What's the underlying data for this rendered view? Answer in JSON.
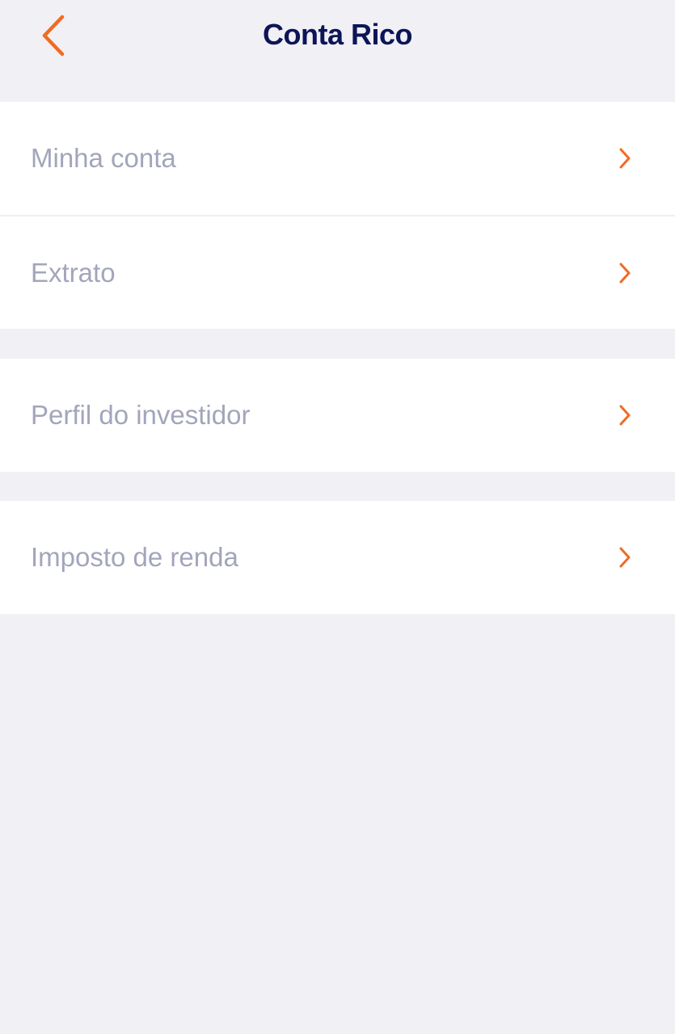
{
  "header": {
    "title": "Conta Rico",
    "back_icon": "chevron-left-icon"
  },
  "colors": {
    "accent": "#f26a21",
    "title": "#0d1557",
    "label": "#a3a5bb",
    "background": "#f0f0f5",
    "card": "#ffffff"
  },
  "groups": [
    {
      "items": [
        {
          "label": "Minha conta",
          "icon": "chevron-right-icon"
        },
        {
          "label": "Extrato",
          "icon": "chevron-right-icon"
        }
      ]
    },
    {
      "items": [
        {
          "label": "Perfil do investidor",
          "icon": "chevron-right-icon"
        }
      ]
    },
    {
      "items": [
        {
          "label": "Imposto de renda",
          "icon": "chevron-right-icon"
        }
      ]
    }
  ]
}
